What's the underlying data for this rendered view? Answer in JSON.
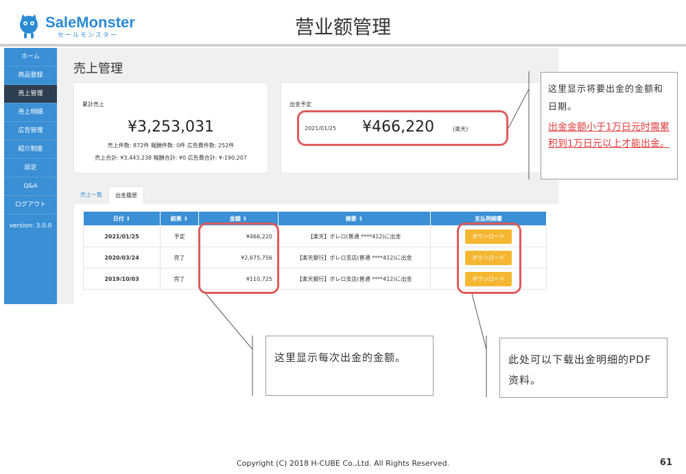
{
  "header": {
    "logo_name": "SaleMonster",
    "logo_sub": "セールモンスター",
    "title": "营业额管理"
  },
  "sidebar": {
    "items": [
      {
        "label": "ホーム"
      },
      {
        "label": "商品登録"
      },
      {
        "label": "売上管理"
      },
      {
        "label": "売上明細"
      },
      {
        "label": "広告管理"
      },
      {
        "label": "紹介制度"
      },
      {
        "label": "設定"
      },
      {
        "label": "Q&A"
      },
      {
        "label": "ログアウト"
      }
    ],
    "version": "version: 3.0.0"
  },
  "main": {
    "title": "売上管理",
    "sales_card": {
      "label": "累計売上",
      "amount": "¥3,253,031",
      "line1": "売上件数: 872件 報酬件数: 0件 広告費件数: 252件",
      "line2": "売上合計: ¥3,443,238 報酬合計: ¥0 広告費合計: ¥-190,207"
    },
    "payout_card": {
      "label": "出金予定",
      "date": "2021/01/25",
      "amount": "¥466,220",
      "bank": "(楽天)"
    },
    "tabs": [
      {
        "label": "売上一覧"
      },
      {
        "label": "出金履歴"
      }
    ],
    "table": {
      "headers": [
        "日付 ⇕",
        "結果 ⇕",
        "金額 ⇕",
        "摘要 ⇕",
        "支払明細書"
      ],
      "rows": [
        {
          "date": "2021/01/25",
          "status": "予定",
          "amount": "¥466,220",
          "memo": "【楽天】ボレロ(普通 ****412)に出金",
          "button": "ダウンロード"
        },
        {
          "date": "2020/03/24",
          "status": "完了",
          "amount": "¥2,675,756",
          "memo": "【楽天銀行】ボレロ支店(普通 ****412)に出金",
          "button": "ダウンロード"
        },
        {
          "date": "2019/10/03",
          "status": "完了",
          "amount": "¥110,725",
          "memo": "【楽天銀行】ボレロ支店(普通 ****412)に出金",
          "button": "ダウンロード"
        }
      ]
    }
  },
  "callouts": {
    "top_right": {
      "text": "这里显示将要出金的金额和日期。",
      "red_text": "出金金额小于1万日元时需累积到1万日元以上才能出金。"
    },
    "amount_note": "这里显示每次出金的金额。",
    "download_note": "此处可以下载出金明细的PDF资料。"
  },
  "footer": {
    "copyright": "Copyright (C) 2018 H-CUBE Co.,Ltd. All Rights Reserved.",
    "page": "61"
  },
  "colors": {
    "sidebar": "#3a8fd5",
    "sidebar_active": "#2c3e50",
    "highlight": "#e05a5a",
    "button": "#f5b731"
  }
}
